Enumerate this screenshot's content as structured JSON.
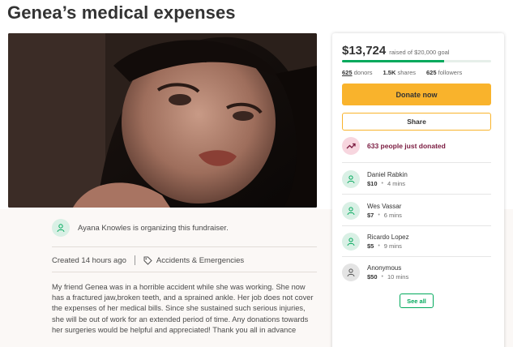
{
  "page": {
    "title": "Genea’s medical expenses"
  },
  "organizer": {
    "text": "Ayana Knowles is organizing this fundraiser."
  },
  "meta": {
    "created": "Created 14 hours ago",
    "category": "Accidents & Emergencies"
  },
  "story": {
    "text": "My friend Genea was in a horrible accident while she was working. She now has a fractured jaw,broken teeth, and a sprained ankle. Her job does not cover the expenses of her medical bills. Since she sustained such serious injuries, she will be out of work for an extended period of time. Any donations towards her surgeries would be helpful and appreciated! Thank you all in advance"
  },
  "campaign": {
    "raised": "$13,724",
    "goal_text": "raised of $20,000 goal",
    "progress_fraction": 0.686,
    "donors_count": "625",
    "donors_label": "donors",
    "shares_count": "1.5K",
    "shares_label": "shares",
    "followers_count": "625",
    "followers_label": "followers",
    "donate_label": "Donate now",
    "share_label": "Share",
    "just_donated": "633 people just donated",
    "see_all_label": "See all"
  },
  "donors": [
    {
      "name": "Daniel Rabkin",
      "amount": "$10",
      "time": "4 mins",
      "icon": "donor-heart-icon"
    },
    {
      "name": "Wes Vassar",
      "amount": "$7",
      "time": "6 mins",
      "icon": "donor-heart-icon"
    },
    {
      "name": "Ricardo Lopez",
      "amount": "$5",
      "time": "9 mins",
      "icon": "donor-heart-icon"
    },
    {
      "name": "Anonymous",
      "amount": "$50",
      "time": "10 mins",
      "icon": "donor-heart-icon"
    }
  ],
  "colors": {
    "brand_green": "#02a95c",
    "donate_yellow": "#f9b32c",
    "donated_text": "#7a1a3f"
  }
}
